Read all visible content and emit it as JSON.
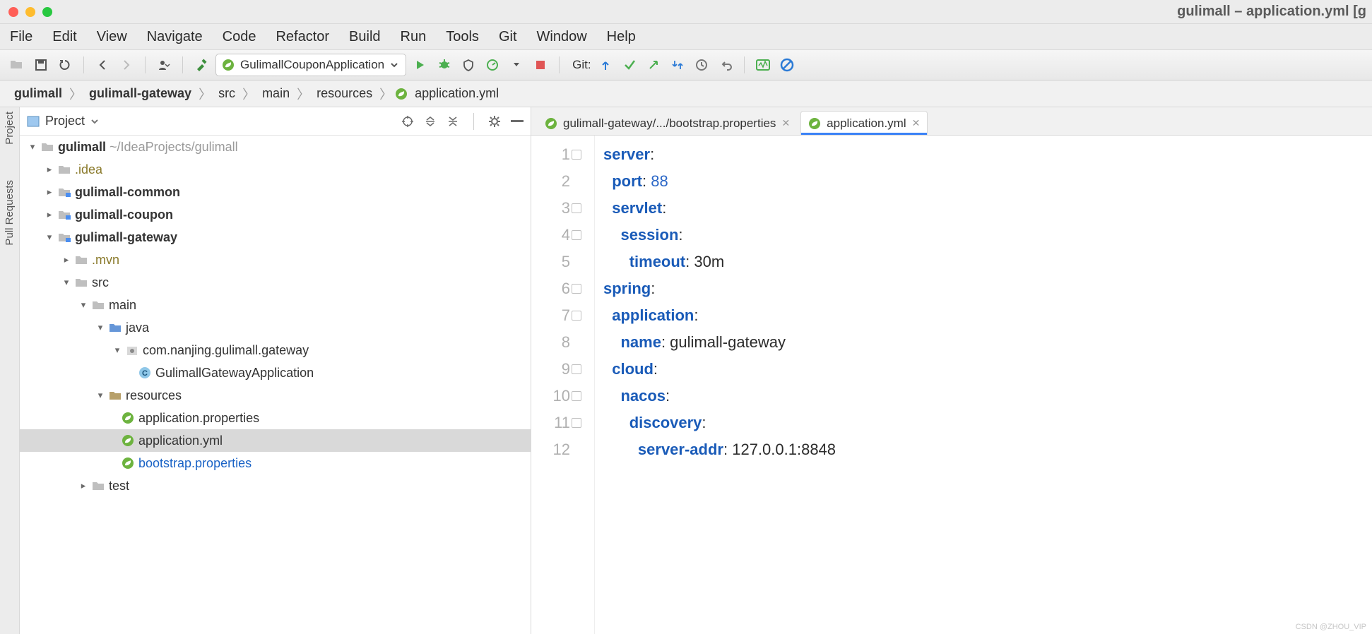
{
  "window": {
    "title": "gulimall – application.yml [g"
  },
  "menu": [
    "File",
    "Edit",
    "View",
    "Navigate",
    "Code",
    "Refactor",
    "Build",
    "Run",
    "Tools",
    "Git",
    "Window",
    "Help"
  ],
  "toolbar": {
    "run_config": "GulimallCouponApplication",
    "git_label": "Git:"
  },
  "breadcrumbs": [
    "gulimall",
    "gulimall-gateway",
    "src",
    "main",
    "resources",
    "application.yml"
  ],
  "sidetabs": {
    "project": "Project",
    "pull": "Pull Requests"
  },
  "project_panel": {
    "title": "Project"
  },
  "tree": {
    "root": {
      "name": "gulimall",
      "path": "~/IdeaProjects/gulimall"
    },
    "idea": ".idea",
    "common": "gulimall-common",
    "coupon": "gulimall-coupon",
    "gateway": "gulimall-gateway",
    "mvn": ".mvn",
    "src": "src",
    "main": "main",
    "java": "java",
    "pkg": "com.nanjing.gulimall.gateway",
    "app": "GulimallGatewayApplication",
    "resources": "resources",
    "appprops": "application.properties",
    "appyml": "application.yml",
    "bootstrap": "bootstrap.properties",
    "test": "test"
  },
  "editor_tabs": [
    {
      "label": "gulimall-gateway/.../bootstrap.properties",
      "active": false
    },
    {
      "label": "application.yml",
      "active": true
    }
  ],
  "code": {
    "lines": [
      {
        "n": 1,
        "html": "<span class='k'>server</span>:"
      },
      {
        "n": 2,
        "html": "  <span class='k'>port</span>: <span class='n'>88</span>"
      },
      {
        "n": 3,
        "html": "  <span class='k'>servlet</span>:"
      },
      {
        "n": 4,
        "html": "    <span class='k'>session</span>:"
      },
      {
        "n": 5,
        "html": "      <span class='k'>timeout</span>: <span class='v'>30m</span>"
      },
      {
        "n": 6,
        "html": "<span class='k'>spring</span>:"
      },
      {
        "n": 7,
        "html": "  <span class='k'>application</span>:"
      },
      {
        "n": 8,
        "html": "    <span class='k'>name</span>: <span class='v'>gulimall-gateway</span>"
      },
      {
        "n": 9,
        "html": "  <span class='k'>cloud</span>:"
      },
      {
        "n": 10,
        "html": "    <span class='k'>nacos</span>:"
      },
      {
        "n": 11,
        "html": "      <span class='k'>discovery</span>:"
      },
      {
        "n": 12,
        "html": "        <span class='k'>server-addr</span>: <span class='v'>127.0.0.1:8848</span>"
      }
    ]
  },
  "watermark": "CSDN @ZHOU_VIP"
}
